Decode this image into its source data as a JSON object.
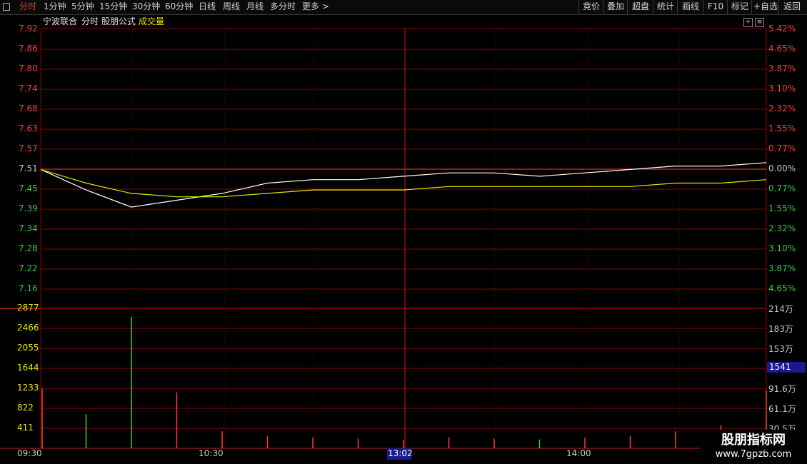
{
  "toolbar": {
    "square_icon": "square-icon",
    "tabs": [
      {
        "label": "分时",
        "active": true
      },
      {
        "label": "1分钟",
        "active": false
      },
      {
        "label": "5分钟",
        "active": false
      },
      {
        "label": "15分钟",
        "active": false
      },
      {
        "label": "30分钟",
        "active": false
      },
      {
        "label": "60分钟",
        "active": false
      },
      {
        "label": "日线",
        "active": false
      },
      {
        "label": "周线",
        "active": false
      },
      {
        "label": "月线",
        "active": false
      },
      {
        "label": "多分时",
        "active": false
      },
      {
        "label": "更多 >",
        "active": false
      }
    ],
    "right_buttons": [
      "竞价",
      "叠加",
      "超盘",
      "统计",
      "画线",
      "F10",
      "标记",
      "+自选",
      "返回"
    ]
  },
  "header": {
    "stock_name": "宁波联合",
    "mode": "分时",
    "formula": "股朋公式",
    "indicator": "成交量"
  },
  "price_axis": {
    "left": [
      "7.92",
      "7.86",
      "7.80",
      "7.74",
      "7.68",
      "7.63",
      "7.57",
      "7.51",
      "7.45",
      "7.39",
      "7.34",
      "7.28",
      "7.22",
      "7.16"
    ],
    "right": [
      "5.42%",
      "4.65%",
      "3.87%",
      "3.10%",
      "2.32%",
      "1.55%",
      "0.77%",
      "0.00%",
      "0.77%",
      "1.55%",
      "2.32%",
      "3.10%",
      "3.87%",
      "4.65%"
    ]
  },
  "volume_axis": {
    "left": [
      "2877",
      "2466",
      "2055",
      "1644",
      "1233",
      "822",
      "411"
    ],
    "right": [
      "214万",
      "183万",
      "153万",
      "",
      "91.6万",
      "61.1万",
      "30.5万"
    ],
    "cursor_value": "1541"
  },
  "time_axis": {
    "labels": [
      "09:30",
      "10:30",
      "13:02",
      "14:00"
    ],
    "cursor_label": "13:02"
  },
  "watermark": {
    "title": "股朋指标网",
    "url": "www.7gpzb.com"
  },
  "colors": {
    "up": "#ff3b3b",
    "down": "#3cc83c",
    "price_line": "#ffffff",
    "avg_line": "#e6e600",
    "grid": "#8b0000",
    "cursor_box": "#1a1a8c"
  },
  "chart_data": {
    "type": "line",
    "title": "",
    "prev_close": 7.51,
    "x": [
      "09:30",
      "09:45",
      "10:00",
      "10:15",
      "10:30",
      "10:45",
      "11:00",
      "11:15",
      "11:30/13:00",
      "13:15",
      "13:30",
      "13:45",
      "14:00",
      "14:15",
      "14:30",
      "14:45",
      "15:00"
    ],
    "series": [
      {
        "values": [
          7.51,
          7.45,
          7.4,
          7.42,
          7.44,
          7.47,
          7.48,
          7.48,
          7.49,
          7.5,
          7.5,
          7.49,
          7.5,
          7.51,
          7.52,
          7.52,
          7.53
        ]
      },
      {
        "values": [
          7.51,
          7.47,
          7.44,
          7.43,
          7.43,
          7.44,
          7.45,
          7.45,
          7.45,
          7.46,
          7.46,
          7.46,
          7.46,
          7.46,
          7.47,
          7.47,
          7.48
        ]
      }
    ],
    "volume": {
      "values": [
        1233,
        700,
        2700,
        1150,
        350,
        250,
        220,
        200,
        180,
        230,
        200,
        180,
        220,
        260,
        350,
        480,
        1200
      ],
      "ylim": [
        0,
        2877
      ]
    },
    "ylim": [
      7.16,
      7.92
    ]
  }
}
